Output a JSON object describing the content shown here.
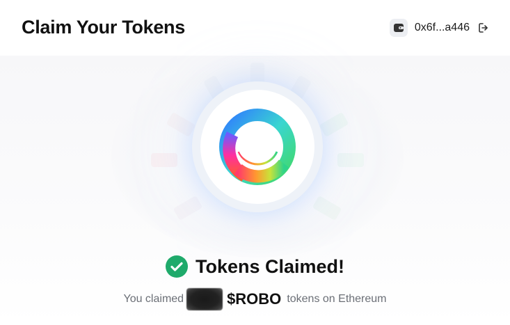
{
  "header": {
    "title": "Claim Your Tokens",
    "wallet_address": "0x6f...a446",
    "wallet_icon": "wallet-icon",
    "logout_icon": "logout-icon"
  },
  "status": {
    "icon": "check-circle-icon",
    "text": "Tokens Claimed!"
  },
  "subtitle": {
    "prefix": "You claimed",
    "ticker": "$ROBO",
    "suffix": "tokens on Ethereum"
  },
  "colors": {
    "success": "#1faa6b",
    "text": "#111111",
    "muted": "#6b6f76"
  }
}
